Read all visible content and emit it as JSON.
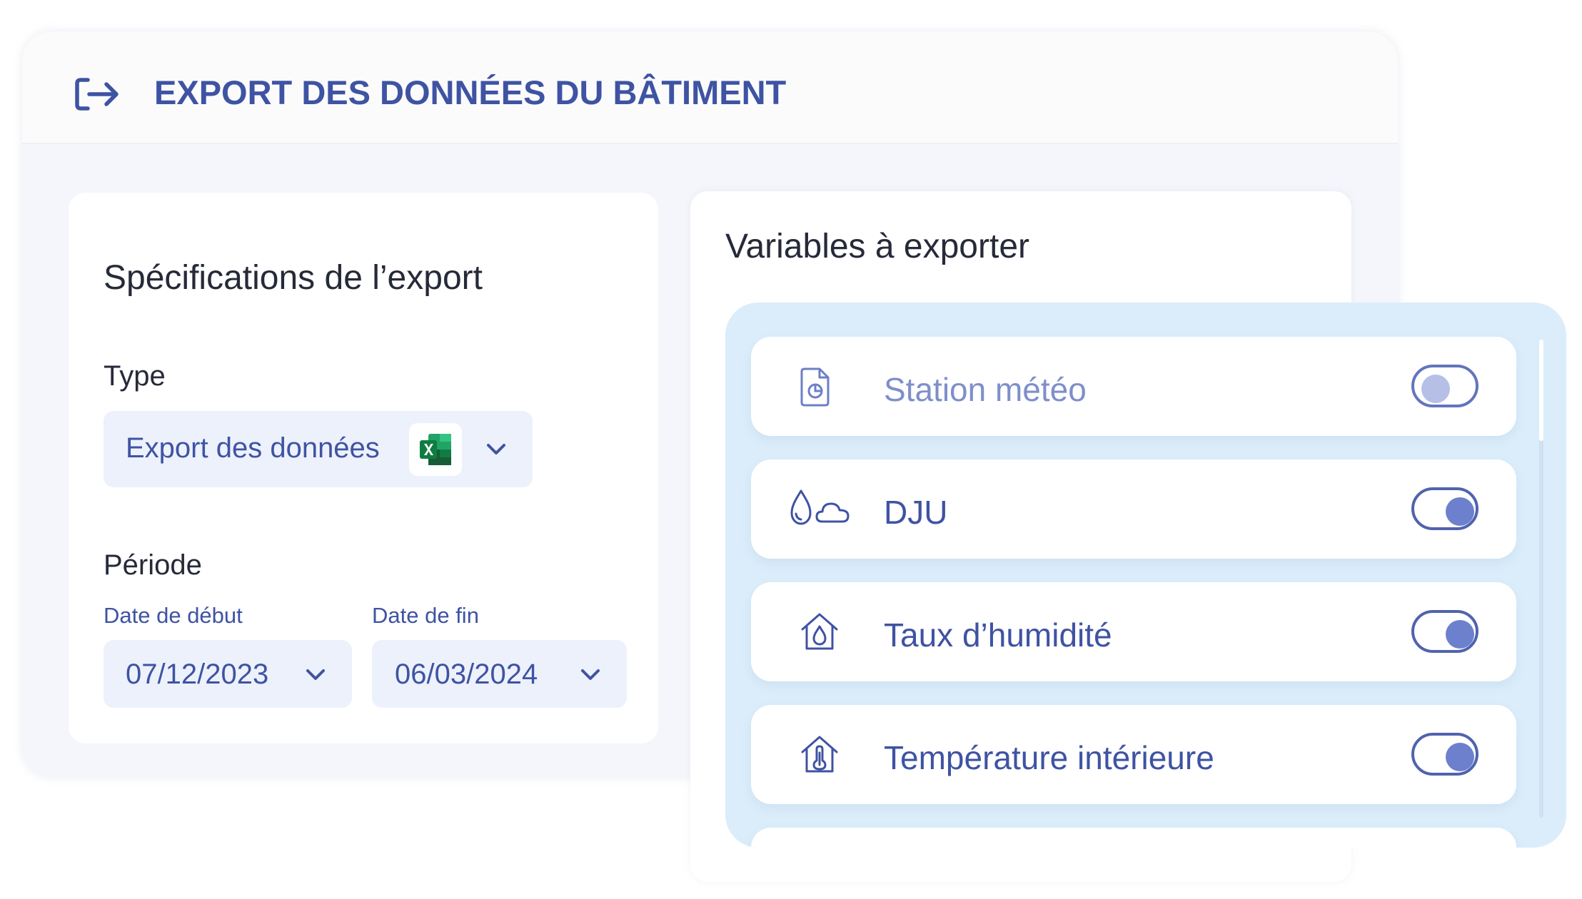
{
  "header": {
    "title": "EXPORT DES DONNÉES DU BÂTIMENT",
    "icon": "export-icon"
  },
  "specs": {
    "title": "Spécifications de l’export",
    "type_label": "Type",
    "type_value": "Export des données",
    "type_icon": "excel-icon",
    "period_label": "Période",
    "start_label": "Date de début",
    "start_value": "07/12/2023",
    "end_label": "Date de fin",
    "end_value": "06/03/2024"
  },
  "variables": {
    "title": "Variables à exporter",
    "items": [
      {
        "label": "Station météo",
        "icon": "weather-station-icon",
        "enabled": false
      },
      {
        "label": "DJU",
        "icon": "drop-cloud-icon",
        "enabled": true
      },
      {
        "label": "Taux d’humidité",
        "icon": "house-humidity-icon",
        "enabled": true
      },
      {
        "label": "Température intérieure",
        "icon": "house-thermometer-icon",
        "enabled": true
      }
    ]
  },
  "colors": {
    "accent": "#3f53a3",
    "toggle_knob_on": "#6d80cd",
    "toggle_knob_off": "#b6c0e6",
    "panel_bg": "#dbedfa",
    "excel_green": "#107c41"
  }
}
